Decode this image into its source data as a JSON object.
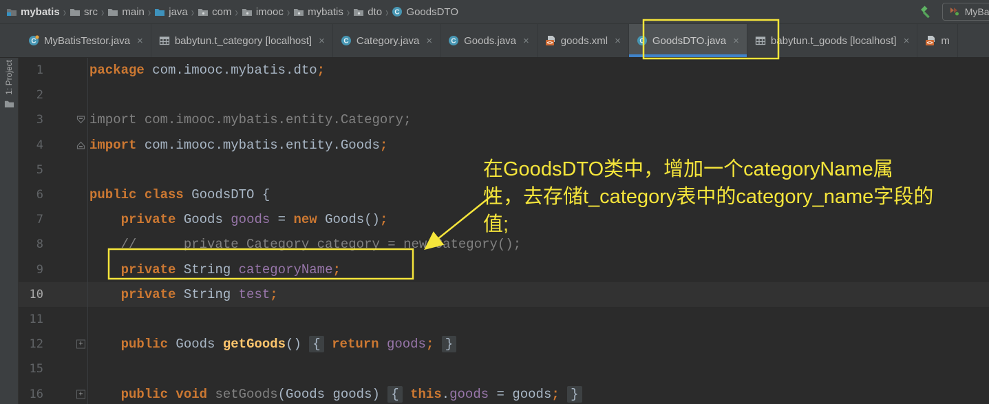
{
  "breadcrumb": {
    "items": [
      {
        "label": "mybatis",
        "icon": "project-folder-icon",
        "first": true
      },
      {
        "label": "src",
        "icon": "folder-icon"
      },
      {
        "label": "main",
        "icon": "folder-icon"
      },
      {
        "label": "java",
        "icon": "source-folder-icon"
      },
      {
        "label": "com",
        "icon": "package-icon"
      },
      {
        "label": "imooc",
        "icon": "package-icon"
      },
      {
        "label": "mybatis",
        "icon": "package-icon"
      },
      {
        "label": "dto",
        "icon": "package-icon"
      },
      {
        "label": "GoodsDTO",
        "icon": "class-icon"
      }
    ]
  },
  "toolbar": {
    "run_config_name": "MyBatisTesto"
  },
  "tool_stripe": {
    "project_button_label": "1: Project"
  },
  "tabs": [
    {
      "label": "MyBatisTestor.java",
      "icon": "test-class-icon",
      "active": false,
      "closable": true
    },
    {
      "label": "babytun.t_category [localhost]",
      "icon": "table-icon",
      "active": false,
      "closable": true
    },
    {
      "label": "Category.java",
      "icon": "class-icon",
      "active": false,
      "closable": true
    },
    {
      "label": "Goods.java",
      "icon": "class-icon",
      "active": false,
      "closable": true
    },
    {
      "label": "goods.xml",
      "icon": "xml-icon",
      "active": false,
      "closable": true
    },
    {
      "label": "GoodsDTO.java",
      "icon": "class-icon",
      "active": true,
      "closable": true
    },
    {
      "label": "babytun.t_goods [localhost]",
      "icon": "table-icon",
      "active": false,
      "closable": true
    },
    {
      "label": "m",
      "icon": "xml-icon",
      "active": false,
      "closable": false
    }
  ],
  "editor": {
    "lines": [
      {
        "num": "1",
        "tokens": [
          [
            "kw",
            "package"
          ],
          [
            "d",
            " com.imooc.mybatis.dto"
          ],
          [
            "sm",
            ";"
          ]
        ]
      },
      {
        "num": "2",
        "tokens": []
      },
      {
        "num": "3",
        "fold": "expand-top",
        "tokens": [
          [
            "cm",
            "import com.imooc.mybatis.entity.Category;"
          ]
        ]
      },
      {
        "num": "4",
        "fold": "expand-bottom",
        "tokens": [
          [
            "kw",
            "import"
          ],
          [
            "d",
            " com.imooc.mybatis.entity.Goods"
          ],
          [
            "sm",
            ";"
          ]
        ]
      },
      {
        "num": "5",
        "tokens": []
      },
      {
        "num": "6",
        "tokens": [
          [
            "kw",
            "public class"
          ],
          [
            "d",
            " GoodsDTO {"
          ]
        ]
      },
      {
        "num": "7",
        "tokens": [
          [
            "d",
            "    "
          ],
          [
            "kw",
            "private"
          ],
          [
            "d",
            " Goods "
          ],
          [
            "f",
            "goods"
          ],
          [
            "d",
            " = "
          ],
          [
            "kw",
            "new"
          ],
          [
            "d",
            " Goods()"
          ],
          [
            "sm",
            ";"
          ]
        ]
      },
      {
        "num": "8",
        "tokens": [
          [
            "cm",
            "    //      private Category category = new Category();"
          ]
        ]
      },
      {
        "num": "9",
        "tokens": [
          [
            "d",
            "    "
          ],
          [
            "kw",
            "private"
          ],
          [
            "d",
            " String "
          ],
          [
            "f",
            "categoryName"
          ],
          [
            "sm",
            ";"
          ]
        ]
      },
      {
        "num": "10",
        "caret": true,
        "tokens": [
          [
            "d",
            "    "
          ],
          [
            "kw",
            "private"
          ],
          [
            "d",
            " String "
          ],
          [
            "f",
            "test"
          ],
          [
            "sm",
            ";"
          ]
        ]
      },
      {
        "num": "11",
        "tokens": []
      },
      {
        "num": "12",
        "fold": "plus",
        "tokens": [
          [
            "d",
            "    "
          ],
          [
            "kw",
            "public"
          ],
          [
            "d",
            " Goods "
          ],
          [
            "m",
            "getGoods"
          ],
          [
            "d",
            "() "
          ],
          [
            "fb",
            "{"
          ],
          [
            "d",
            " "
          ],
          [
            "kw",
            "return"
          ],
          [
            "d",
            " "
          ],
          [
            "f",
            "goods"
          ],
          [
            "sm",
            ";"
          ],
          [
            "d",
            " "
          ],
          [
            "fb",
            "}"
          ]
        ]
      },
      {
        "num": "15",
        "tokens": []
      },
      {
        "num": "16",
        "fold": "plus",
        "tokens": [
          [
            "d",
            "    "
          ],
          [
            "kw",
            "public void"
          ],
          [
            "d",
            " "
          ],
          [
            "gm",
            "setGoods"
          ],
          [
            "d",
            "(Goods goods) "
          ],
          [
            "fb",
            "{"
          ],
          [
            "d",
            " "
          ],
          [
            "kw",
            "this"
          ],
          [
            "d",
            "."
          ],
          [
            "f",
            "goods"
          ],
          [
            "d",
            " = goods"
          ],
          [
            "sm",
            ";"
          ],
          [
            "d",
            " "
          ],
          [
            "fb",
            "}"
          ]
        ]
      }
    ]
  },
  "annotation": {
    "lines": [
      "在GoodsDTO类中，增加一个categoryName属",
      "性，去存储t_category表中的category_name字段的",
      "值;"
    ],
    "color": "#F5E53B"
  },
  "colors": {
    "editor_bg": "#2B2B2B",
    "bar_bg": "#3C3F41",
    "active_tab_bg": "#4E5254",
    "tab_underline": "#4083C9",
    "keyword": "#CC7832",
    "field": "#9876AA",
    "method": "#FFC66D",
    "comment": "#808080",
    "default_text": "#A9B7C6",
    "annotation_yellow": "#F5E53B"
  }
}
